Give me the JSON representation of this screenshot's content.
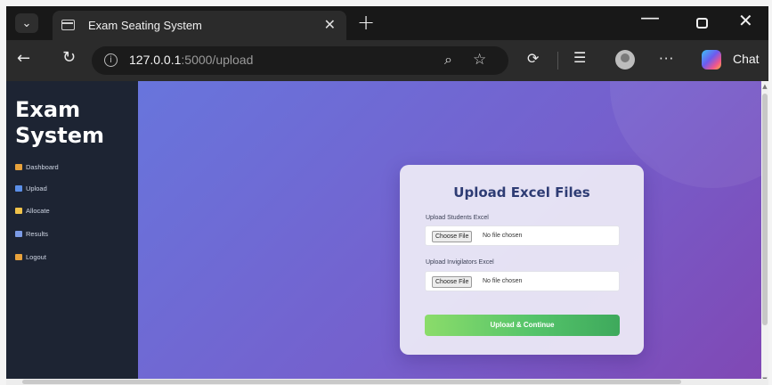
{
  "browser": {
    "tab": {
      "title": "Exam Seating System",
      "close": "✕"
    },
    "new_tab": "+",
    "window": {
      "minimize": "—",
      "close": "✕"
    },
    "url": {
      "host": "127.0.0.1",
      "path": ":5000/upload"
    },
    "chat_label": "Chat"
  },
  "sidebar": {
    "brand_line1": "Exam",
    "brand_line2": "System",
    "items": [
      {
        "label": "Dashboard",
        "icon": "home-icon",
        "color": "#e8a23c"
      },
      {
        "label": "Upload",
        "icon": "upload-icon",
        "color": "#5b8fe8"
      },
      {
        "label": "Allocate",
        "icon": "allocate-icon",
        "color": "#f0c24a"
      },
      {
        "label": "Results",
        "icon": "results-icon",
        "color": "#7c9be6"
      },
      {
        "label": "Logout",
        "icon": "logout-icon",
        "color": "#e8a23c"
      }
    ]
  },
  "upload_card": {
    "title": "Upload Excel Files",
    "students_label": "Upload Students Excel",
    "invigilators_label": "Upload Invigilators Excel",
    "choose_file": "Choose File",
    "no_file": "No file chosen",
    "submit": "Upload & Continue"
  },
  "colors": {
    "sidebar_bg": "#1d2433",
    "gradient_start": "#6875dc",
    "gradient_end": "#8048b4",
    "button_green": "#55c46a",
    "title_navy": "#2e3c74"
  }
}
